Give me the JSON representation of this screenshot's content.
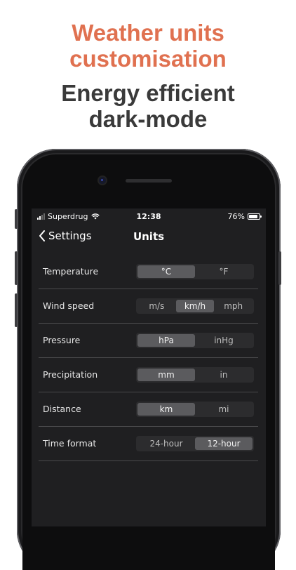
{
  "promo": {
    "headline_accent_lines": [
      "Weather units",
      "customisation"
    ],
    "headline_dark_lines": [
      "Energy efficient",
      "dark-mode"
    ],
    "accent_color": "#e07150"
  },
  "status_bar": {
    "carrier": "Superdrug",
    "time": "12:38",
    "battery": "76%"
  },
  "nav": {
    "back_label": "Settings",
    "title": "Units"
  },
  "settings": [
    {
      "label": "Temperature",
      "options": [
        "°C",
        "°F"
      ],
      "selected": 0
    },
    {
      "label": "Wind speed",
      "options": [
        "m/s",
        "km/h",
        "mph"
      ],
      "selected": 1
    },
    {
      "label": "Pressure",
      "options": [
        "hPa",
        "inHg"
      ],
      "selected": 0
    },
    {
      "label": "Precipitation",
      "options": [
        "mm",
        "in"
      ],
      "selected": 0
    },
    {
      "label": "Distance",
      "options": [
        "km",
        "mi"
      ],
      "selected": 0
    },
    {
      "label": "Time format",
      "options": [
        "24-hour",
        "12-hour"
      ],
      "selected": 1
    }
  ]
}
